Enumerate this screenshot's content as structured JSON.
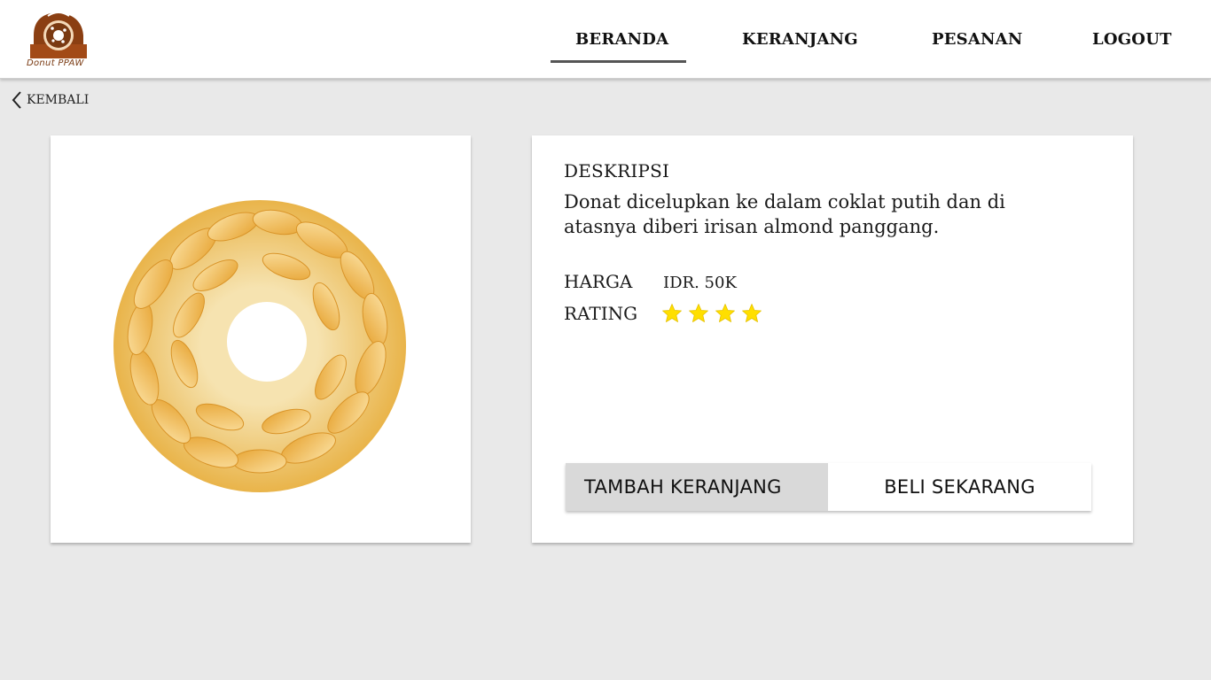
{
  "brand": {
    "name": "Donut PPAW",
    "color": "#7a3a12"
  },
  "nav": {
    "items": [
      {
        "label": "BERANDA",
        "active": true
      },
      {
        "label": "KERANJANG",
        "active": false
      },
      {
        "label": "PESANAN",
        "active": false
      },
      {
        "label": "LOGOUT",
        "active": false
      }
    ]
  },
  "back": {
    "label": "KEMBALI",
    "icon": "chevron-left-icon"
  },
  "product": {
    "image": "almond-donut",
    "description_title": "DESKRIPSI",
    "description": "Donat dicelupkan ke dalam coklat putih dan di atasnya diberi irisan almond panggang.",
    "price_label": "HARGA",
    "price": "IDR. 50K",
    "rating_label": "RATING",
    "rating": 4,
    "star_color": "#ffdf00"
  },
  "actions": {
    "add_to_cart": "TAMBAH KERANJANG",
    "buy_now": "BELI SEKARANG"
  }
}
